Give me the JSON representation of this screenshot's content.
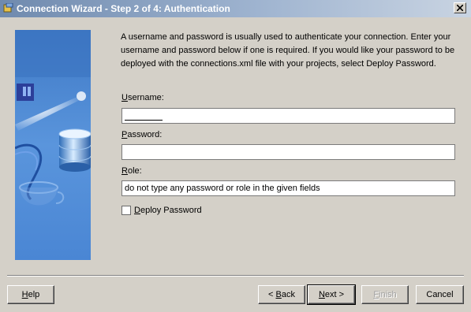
{
  "window": {
    "title": "Connection Wizard - Step 2 of 4: Authentication"
  },
  "intro_text": "A username and password is usually used to authenticate your connection.  Enter your username and password below if one is required.  If you would like your password to be deployed with the connections.xml file with your projects, select Deploy Password.",
  "fields": {
    "username": {
      "label_mnemonic": "U",
      "label_rest": "sername:",
      "value": ""
    },
    "password": {
      "label_mnemonic": "P",
      "label_rest": "assword:",
      "value": ""
    },
    "role": {
      "label_mnemonic": "R",
      "label_rest": "ole:",
      "value": "do not type any password or role in the given fields"
    }
  },
  "deploy_password": {
    "label_mnemonic": "D",
    "label_rest": "eploy Password",
    "checked": false
  },
  "buttons": {
    "help_mnemonic": "H",
    "help_rest": "elp",
    "back_prefix": "< ",
    "back_mnemonic": "B",
    "back_rest": "ack",
    "next_mnemonic": "N",
    "next_rest": "ext >",
    "finish_mnemonic": "F",
    "finish_rest": "inish",
    "cancel": "Cancel"
  },
  "colors": {
    "title_gradient_start": "#6f8aae",
    "side_panel_blue": "#4a86d4",
    "dialog_background": "#d4d0c8"
  },
  "icons": [
    "wizard-title-icon",
    "close-icon",
    "database-illustration"
  ]
}
